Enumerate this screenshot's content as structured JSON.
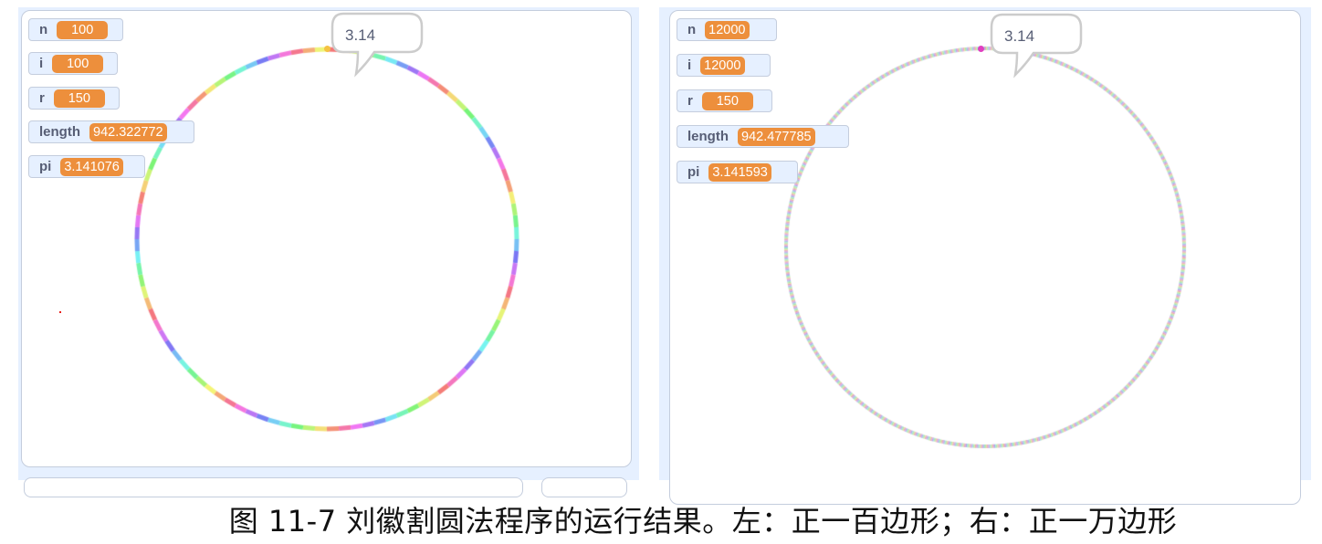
{
  "left_panel": {
    "monitors": [
      {
        "label": "n",
        "value": "100"
      },
      {
        "label": "i",
        "value": "100"
      },
      {
        "label": "r",
        "value": "150"
      },
      {
        "label": "length",
        "value": "942.322772"
      },
      {
        "label": "pi",
        "value": "3.141076"
      }
    ],
    "speech_bubble": "3.14",
    "polygon_sides": 100,
    "pen_style": "rainbow-segments",
    "sprite_color": "#f5c242"
  },
  "right_panel": {
    "monitors": [
      {
        "label": "n",
        "value": "12000"
      },
      {
        "label": "i",
        "value": "12000"
      },
      {
        "label": "r",
        "value": "150"
      },
      {
        "label": "length",
        "value": "942.477785"
      },
      {
        "label": "pi",
        "value": "3.141593"
      }
    ],
    "speech_bubble": "3.14",
    "polygon_sides": 12000,
    "pen_style": "fine-rainbow-dither",
    "sprite_color": "#e040c0"
  },
  "caption": "图 11-7 刘徽割圆法程序的运行结果。左：正一百边形；右：正一万边形",
  "colors": {
    "monitor_value_bg": "#ed8f3c",
    "monitor_bg": "#e6f0ff",
    "monitor_label": "#575e75",
    "stage_border": "#c4cddd",
    "stray_dot": "#e8201c"
  }
}
